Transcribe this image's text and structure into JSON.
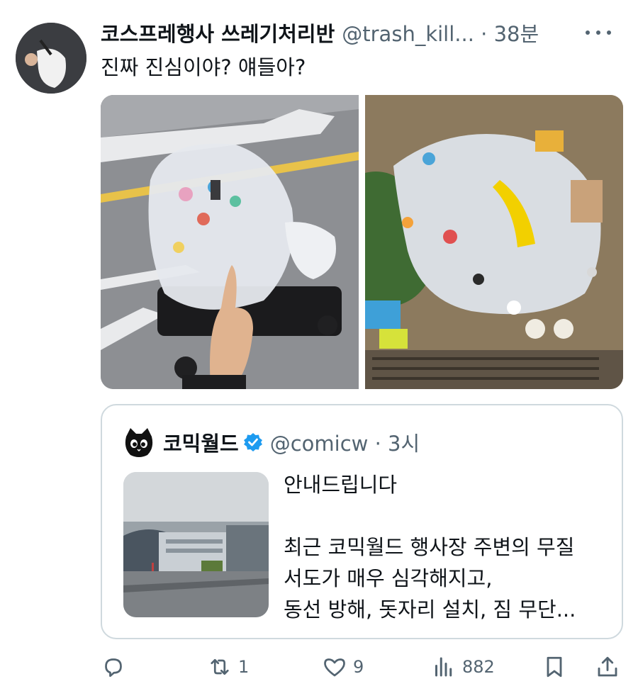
{
  "tweet": {
    "display_name": "코스프레행사 쓰레기처리반",
    "handle_time": "@trash_kill... · 38분",
    "text": "진짜 진심이야? 얘들아?",
    "media": [
      {
        "icon": "photo-trash-cart"
      },
      {
        "icon": "photo-trash-pile"
      }
    ]
  },
  "quote": {
    "display_name": "코믹월드",
    "handle_time": "@comicw · 3시",
    "text": "안내드립니다\n\n최근 코믹월드 행사장 주변의 무질\n서도가 매우 심각해지고,\n동선 방해, 돗자리 설치, 짐 무단..."
  },
  "actions": {
    "reply": {
      "icon": "reply-icon",
      "count": ""
    },
    "repost": {
      "icon": "repost-icon",
      "count": "1"
    },
    "like": {
      "icon": "like-icon",
      "count": "9"
    },
    "views": {
      "icon": "views-icon",
      "count": "882"
    },
    "bookmark": {
      "icon": "bookmark-icon"
    },
    "share": {
      "icon": "share-icon"
    }
  },
  "colors": {
    "text": "#0f1419",
    "secondary": "#536471",
    "border": "#cfd9de",
    "verified": "#1d9bf0"
  }
}
